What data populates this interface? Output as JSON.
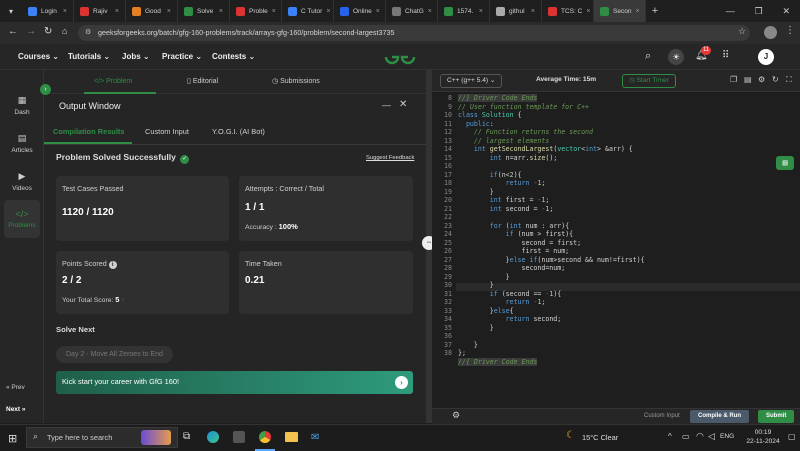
{
  "browser": {
    "tabs": [
      {
        "label": "Login",
        "color": "#3b82f6"
      },
      {
        "label": "Rajiv",
        "color": "#d33"
      },
      {
        "label": "Good",
        "color": "#e67e22"
      },
      {
        "label": "Solve",
        "color": "#2f8d46"
      },
      {
        "label": "Proble",
        "color": "#d33"
      },
      {
        "label": "C Tutor",
        "color": "#3b82f6"
      },
      {
        "label": "Online",
        "color": "#2563eb"
      },
      {
        "label": "ChatG",
        "color": "#777"
      },
      {
        "label": "1574.",
        "color": "#2f8d46"
      },
      {
        "label": "githul",
        "color": "#aaa"
      },
      {
        "label": "TCS: C",
        "color": "#d33"
      },
      {
        "label": "Secon",
        "color": "#2f8d46"
      }
    ],
    "new_tab": "+",
    "url": "geeksforgeeks.org/batch/gfg-160-problems/track/arrays-gfg-160/problem/second-largest3735"
  },
  "gfg_nav": {
    "items": [
      "Courses",
      "Tutorials",
      "Jobs",
      "Practice",
      "Contests"
    ],
    "notification_count": "11",
    "avatar_letter": "J"
  },
  "sidebar": {
    "items": [
      "Dash",
      "Articles",
      "Videos",
      "Problems"
    ],
    "prev": "Prev",
    "next": "Next"
  },
  "problem_tabs": [
    "Problem",
    "Editorial",
    "Submissions"
  ],
  "output": {
    "title": "Output Window",
    "tabs": [
      "Compilation Results",
      "Custom Input",
      "Y.O.G.I. (AI Bot)"
    ],
    "status": "Problem Solved Successfully",
    "feedback": "Suggest Feedback",
    "test_cases_label": "Test Cases Passed",
    "test_cases_value": "1120 / 1120",
    "attempts_label": "Attempts : Correct / Total",
    "attempts_value": "1 / 1",
    "accuracy_label": "Accuracy :",
    "accuracy_value": "100%",
    "points_label": "Points Scored",
    "points_value": "2 / 2",
    "total_score_label": "Your Total Score:",
    "total_score_value": "5",
    "time_label": "Time Taken",
    "time_value": "0.21",
    "solve_next": "Solve Next",
    "next_problem": "Day 2 - Move All Zeroes to End",
    "banner": "Kick start your career with GfG 160!"
  },
  "editor": {
    "language": "C++ (g++ 5.4)",
    "average_time": "Average Time: 15m",
    "timer": "Start Timer",
    "custom_input": "Custom Input",
    "compile_run": "Compile & Run",
    "submit": "Submit"
  },
  "taskbar": {
    "search_placeholder": "Type here to search",
    "weather": "15°C  Clear",
    "lang": "ENG",
    "time": "00:19",
    "date": "22-11-2024"
  }
}
